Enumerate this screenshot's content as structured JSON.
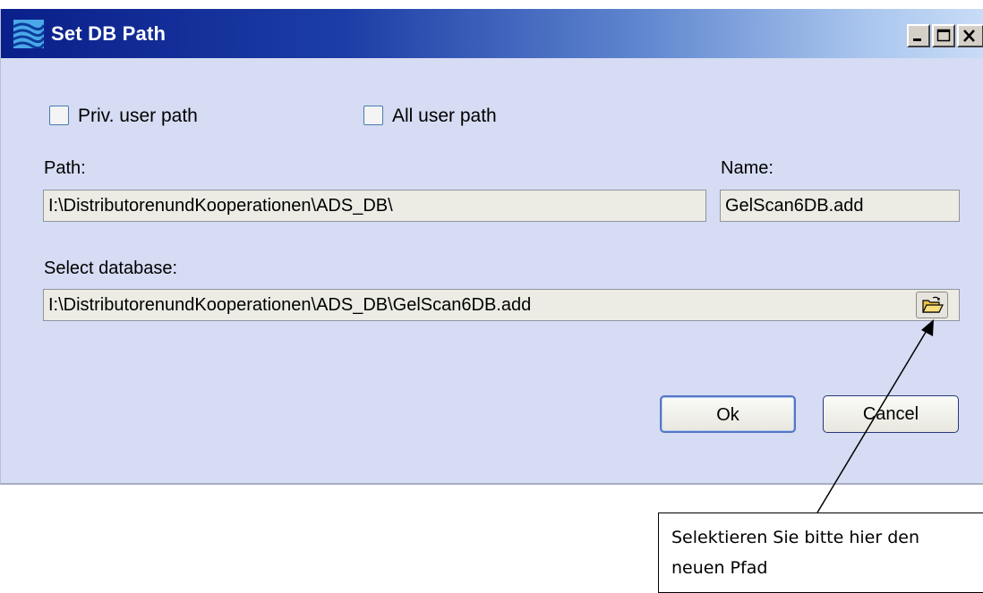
{
  "window": {
    "title": "Set DB Path",
    "minimize_label": "_",
    "maximize_label": "□",
    "close_label": "×"
  },
  "options": {
    "priv_user_path": {
      "label": "Priv. user path",
      "checked": false
    },
    "all_user_path": {
      "label": "All user path",
      "checked": false
    }
  },
  "path": {
    "label": "Path:",
    "value": "I:\\DistributorenundKooperationen\\ADS_DB\\"
  },
  "name": {
    "label": "Name:",
    "value": "GelScan6DB.add"
  },
  "database": {
    "label": "Select database:",
    "value": "I:\\DistributorenundKooperationen\\ADS_DB\\GelScan6DB.add",
    "browse_icon": "open-folder-icon"
  },
  "buttons": {
    "ok_label": "Ok",
    "cancel_label": "Cancel"
  },
  "annotation": {
    "text_line1": "Selektieren Sie bitte hier den",
    "text_line2": "neuen Pfad"
  },
  "colors": {
    "dialog_bg": "#d5dcf3",
    "title_start": "#0a1f8a",
    "title_end": "#c8dcf6",
    "field_bg": "#ecece5",
    "checkbox_border": "#4b7ab3"
  }
}
